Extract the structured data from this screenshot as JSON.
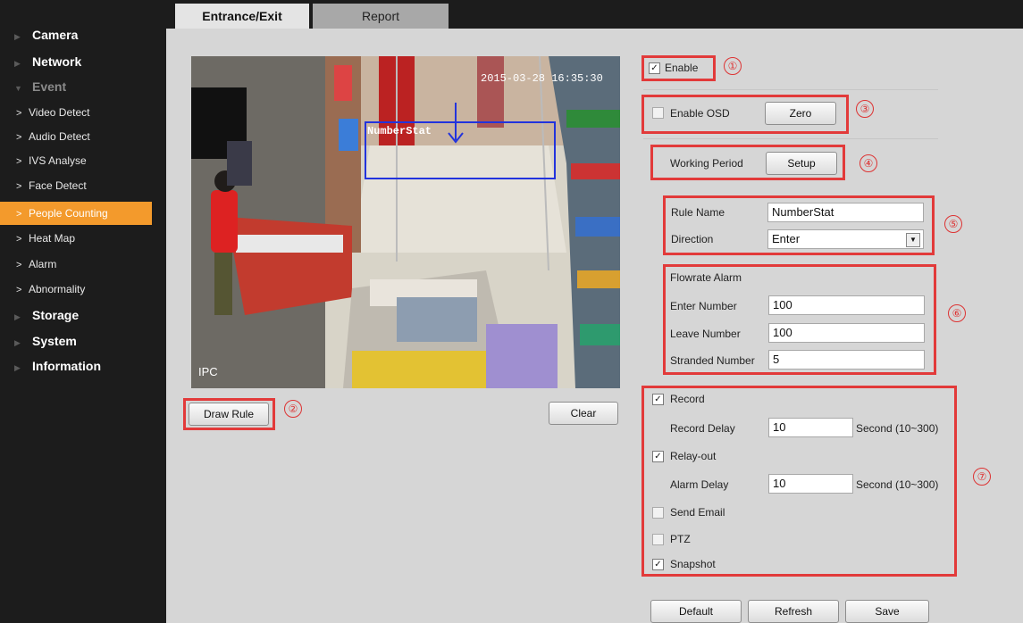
{
  "sidebar": {
    "top": [
      {
        "label": "Camera"
      },
      {
        "label": "Network"
      },
      {
        "label": "Event"
      }
    ],
    "event_items": [
      {
        "label": "Video Detect"
      },
      {
        "label": "Audio Detect"
      },
      {
        "label": "IVS Analyse"
      },
      {
        "label": "Face Detect"
      },
      {
        "label": "People Counting"
      },
      {
        "label": "Heat Map"
      },
      {
        "label": "Alarm"
      },
      {
        "label": "Abnormality"
      }
    ],
    "bottom": [
      {
        "label": "Storage"
      },
      {
        "label": "System"
      },
      {
        "label": "Information"
      }
    ]
  },
  "tabs": [
    "Entrance/Exit",
    "Report"
  ],
  "video": {
    "timestamp": "2015-03-28 16:35:30",
    "rule_label": "NumberStat",
    "channel_label": "IPC"
  },
  "buttons": {
    "draw_rule": "Draw Rule",
    "clear": "Clear",
    "zero": "Zero",
    "setup": "Setup",
    "default": "Default",
    "refresh": "Refresh",
    "save": "Save"
  },
  "annotations": [
    "①",
    "②",
    "③",
    "④",
    "⑤",
    "⑥",
    "⑦"
  ],
  "settings": {
    "enable": {
      "label": "Enable",
      "checked": true
    },
    "enable_osd": {
      "label": "Enable OSD",
      "checked": false
    },
    "working_period": "Working Period",
    "rule_name": {
      "label": "Rule Name",
      "value": "NumberStat"
    },
    "direction": {
      "label": "Direction",
      "value": "Enter"
    },
    "flowrate_alarm": "Flowrate Alarm",
    "enter_number": {
      "label": "Enter Number",
      "value": "100"
    },
    "leave_number": {
      "label": "Leave Number",
      "value": "100"
    },
    "stranded_number": {
      "label": "Stranded Number",
      "value": "5"
    },
    "record": {
      "label": "Record",
      "checked": true
    },
    "record_delay": {
      "label": "Record Delay",
      "value": "10",
      "unit": "Second (10~300)"
    },
    "relay_out": {
      "label": "Relay-out",
      "checked": true
    },
    "alarm_delay": {
      "label": "Alarm Delay",
      "value": "10",
      "unit": "Second (10~300)"
    },
    "send_email": {
      "label": "Send Email",
      "checked": false
    },
    "ptz": {
      "label": "PTZ",
      "checked": false
    },
    "snapshot": {
      "label": "Snapshot",
      "checked": true
    }
  },
  "colors": {
    "accent": "#f39a2c",
    "annotation": "#e23a3a",
    "rule_box": "#2233dd"
  }
}
